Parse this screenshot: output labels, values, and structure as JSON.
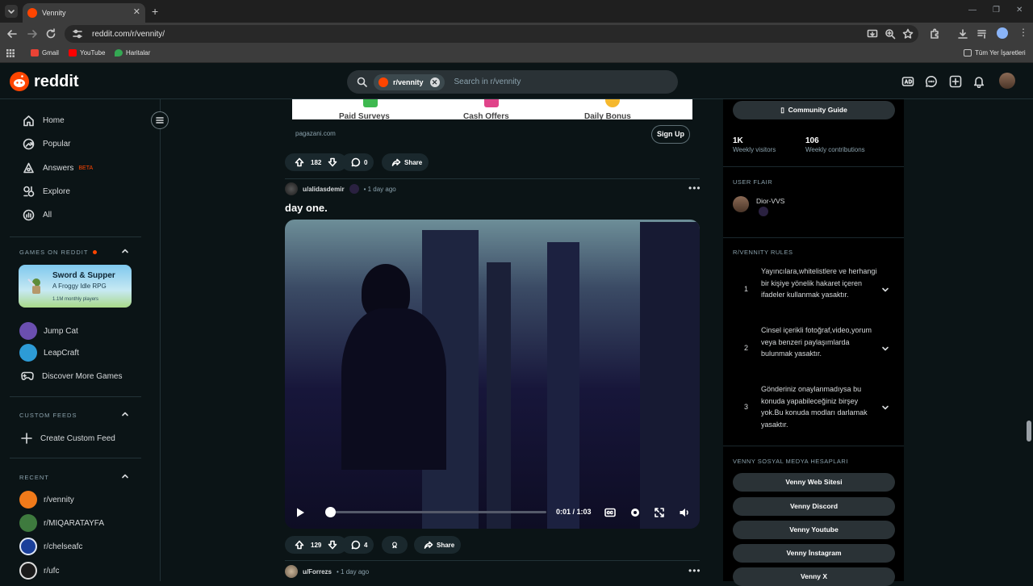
{
  "browser": {
    "tab_title": "Vennity",
    "url": "reddit.com/r/vennity/",
    "bookmarks": [
      "Gmail",
      "YouTube",
      "Haritalar"
    ],
    "all_bookmarks": "Tüm Yer İşaretleri"
  },
  "header": {
    "logo": "reddit",
    "search_chip": "r/vennity",
    "search_placeholder": "Search in r/vennity"
  },
  "sidebar": {
    "nav": [
      {
        "label": "Home",
        "icon": "home-icon"
      },
      {
        "label": "Popular",
        "icon": "popular-icon"
      },
      {
        "label": "Answers",
        "icon": "answers-icon",
        "badge": "BETA"
      },
      {
        "label": "Explore",
        "icon": "explore-icon"
      },
      {
        "label": "All",
        "icon": "all-icon"
      }
    ],
    "games_header": "GAMES ON REDDIT",
    "game_card": {
      "title": "Sword & Supper",
      "subtitle": "A Froggy Idle RPG",
      "meta": "1.1M monthly players"
    },
    "games": [
      "Jump Cat",
      "LeapCraft",
      "Discover More Games"
    ],
    "custom_feeds_header": "CUSTOM FEEDS",
    "create_feed": "Create Custom Feed",
    "recent_header": "RECENT",
    "recent": [
      "r/vennity",
      "r/MIQARATAYFA",
      "r/chelseafc",
      "r/ufc"
    ]
  },
  "feed": {
    "ad": {
      "labels": [
        "Paid Surveys",
        "Cash Offers",
        "Daily Bonus"
      ],
      "domain": "pagazani.com",
      "cta": "Sign Up",
      "votes": "182",
      "comments": "0",
      "share": "Share"
    },
    "post": {
      "user": "u/alidasdemir",
      "time": "1 day ago",
      "title": "day one.",
      "video_time": "0:01 / 1:03",
      "progress": 0.016,
      "votes": "129",
      "comments": "4",
      "share": "Share"
    },
    "next_post": {
      "user": "u/Forrezs",
      "time": "1 day ago"
    }
  },
  "right": {
    "guide_button": "Community Guide",
    "stats": [
      {
        "value": "1K",
        "label": "Weekly visitors"
      },
      {
        "value": "106",
        "label": "Weekly contributions"
      }
    ],
    "user_flair_header": "USER FLAIR",
    "flair_name": "Dior-VVS",
    "rules_header": "R/VENNITY RULES",
    "rules": [
      {
        "n": "1",
        "text": "Yayıncılara,whitelistlere ve herhangi bir kişiye yönelik hakaret içeren ifadeler kullanmak yasaktır."
      },
      {
        "n": "2",
        "text": "Cinsel içerikli fotoğraf,video,yorum veya benzeri paylaşımlarda bulunmak yasaktır."
      },
      {
        "n": "3",
        "text": "Gönderiniz onaylanmadıysa bu konuda yapabileceğiniz birşey yok.Bu konuda modları darlamak yasaktır."
      }
    ],
    "social_header": "VENNY SOSYAL MEDYA HESAPLARI",
    "social_links": [
      "Venny Web Sitesi",
      "Venny Discord",
      "Venny Youtube",
      "Venny İnstagram",
      "Venny X"
    ]
  },
  "colors": {
    "brand": "#ff4500",
    "bg": "#0b1416",
    "panel": "#000000"
  }
}
